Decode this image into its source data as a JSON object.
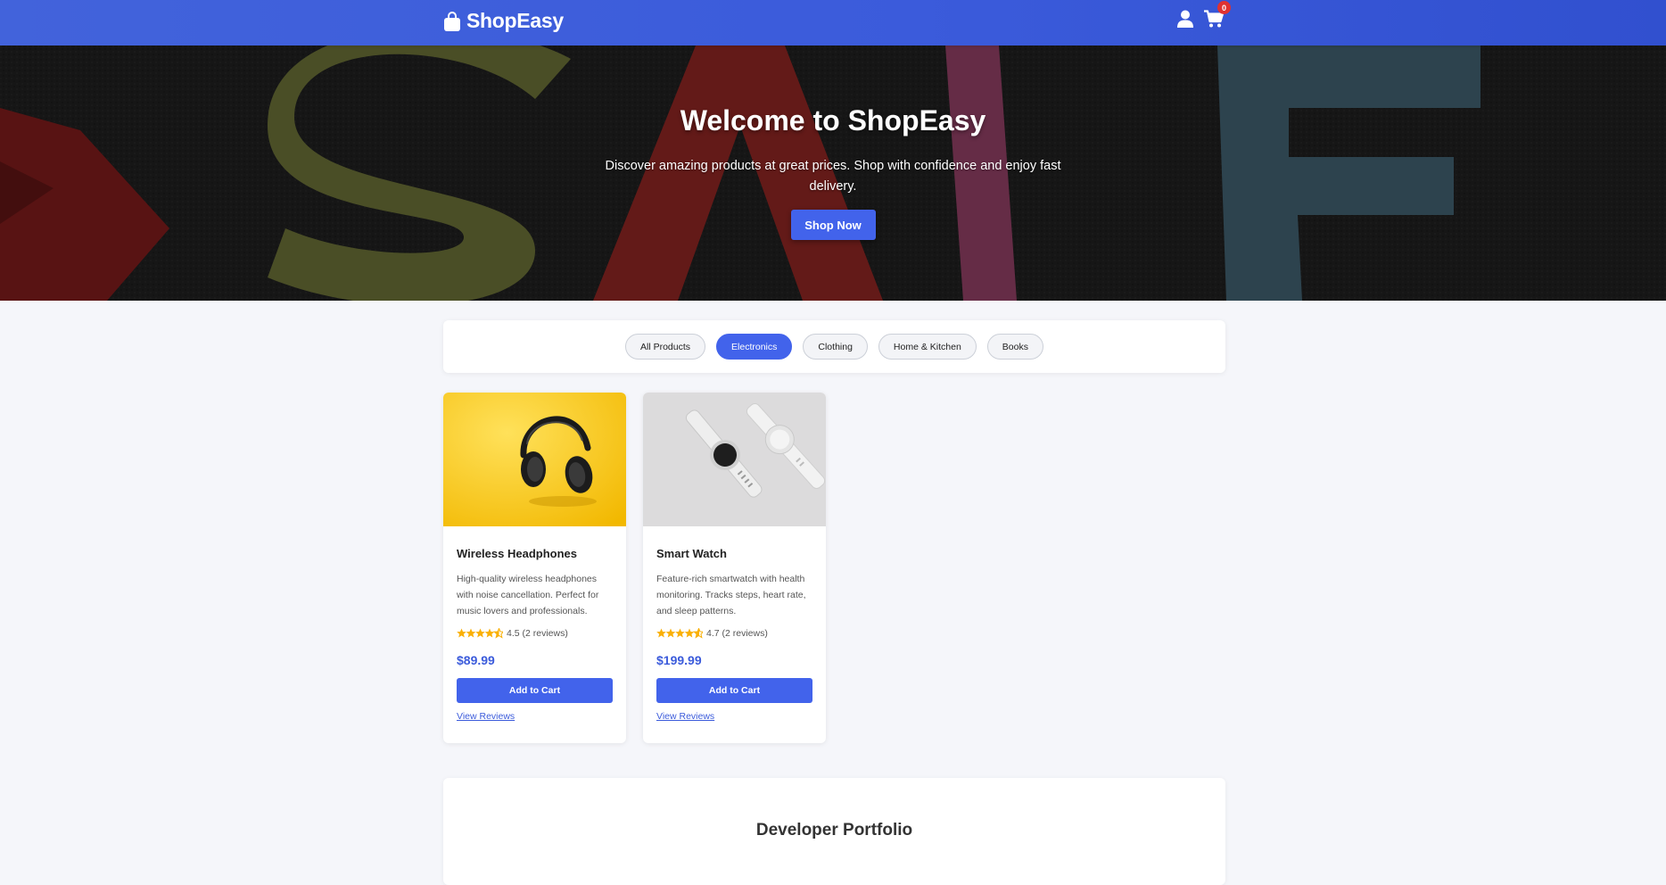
{
  "header": {
    "brand": "ShopEasy",
    "cart_count": "0",
    "brand_color": "#3b5bdb"
  },
  "hero": {
    "title": "Welcome to ShopEasy",
    "subtitle": "Discover amazing products at great prices. Shop with confidence and enjoy fast delivery.",
    "cta": "Shop Now",
    "background_text": "SALE"
  },
  "filters": {
    "items": [
      {
        "label": "All Products",
        "active": false
      },
      {
        "label": "Electronics",
        "active": true
      },
      {
        "label": "Clothing",
        "active": false
      },
      {
        "label": "Home & Kitchen",
        "active": false
      },
      {
        "label": "Books",
        "active": false
      }
    ]
  },
  "products": [
    {
      "name": "Wireless Headphones",
      "description": "High-quality wireless headphones with noise cancellation. Perfect for music lovers and professionals.",
      "rating": "4.5",
      "rating_text": "4.5 (2 reviews)",
      "price": "$89.99",
      "add_label": "Add to Cart",
      "reviews_label": "View Reviews",
      "image_icon": "headphones"
    },
    {
      "name": "Smart Watch",
      "description": "Feature-rich smartwatch with health monitoring. Tracks steps, heart rate, and sleep patterns.",
      "rating": "4.7",
      "rating_text": "4.7 (2 reviews)",
      "price": "$199.99",
      "add_label": "Add to Cart",
      "reviews_label": "View Reviews",
      "image_icon": "smartwatch"
    }
  ],
  "portfolio": {
    "title": "Developer Portfolio"
  },
  "colors": {
    "accent": "#4263eb",
    "star": "#fab005",
    "badge": "#e03131"
  }
}
